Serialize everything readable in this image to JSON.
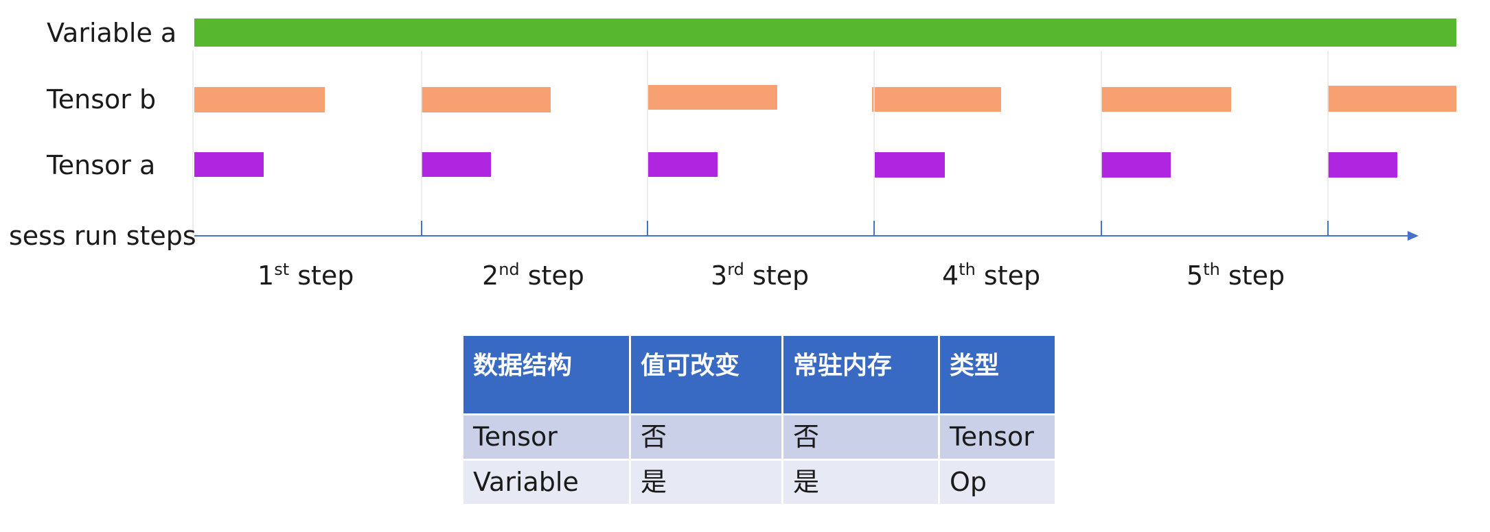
{
  "rows": [
    {
      "label": "Variable a",
      "color": "#57b82f"
    },
    {
      "label": "Tensor b",
      "color": "#f7a072"
    },
    {
      "label": "Tensor a",
      "color": "#b026e0"
    }
  ],
  "axis_label": "sess run steps",
  "axis_color": "#4472c4",
  "steps": [
    {
      "num": "1",
      "sup": "st",
      "word": " step"
    },
    {
      "num": "2",
      "sup": "nd",
      "word": " step"
    },
    {
      "num": "3",
      "sup": "rd",
      "word": " step"
    },
    {
      "num": "4",
      "sup": "th",
      "word": " step"
    },
    {
      "num": "5",
      "sup": "th",
      "word": " step"
    }
  ],
  "table": {
    "headers": [
      "数据结构",
      "值可改变",
      "常驻内存",
      "类型"
    ],
    "rows": [
      [
        "Tensor",
        "否",
        "否",
        "Tensor"
      ],
      [
        "Variable",
        "是",
        "是",
        "Op"
      ]
    ],
    "header_color": "#3869c3"
  }
}
